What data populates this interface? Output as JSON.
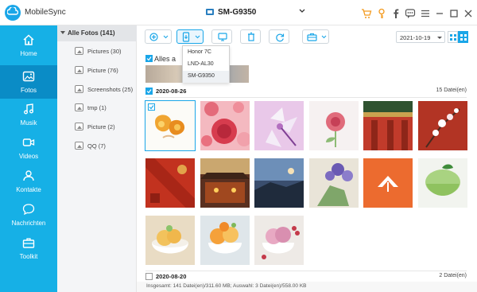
{
  "app": {
    "name": "MobileSync"
  },
  "device": {
    "name": "SM-G9350"
  },
  "titlebar_icons": [
    "cart-icon",
    "key-icon",
    "facebook-icon",
    "chat-icon",
    "menu-icon",
    "minimize-icon",
    "maximize-icon",
    "close-icon"
  ],
  "sidebar": {
    "items": [
      {
        "label": "Home",
        "icon": "home-icon"
      },
      {
        "label": "Fotos",
        "icon": "photo-icon",
        "active": true
      },
      {
        "label": "Musik",
        "icon": "music-icon"
      },
      {
        "label": "Videos",
        "icon": "video-icon"
      },
      {
        "label": "Kontakte",
        "icon": "contacts-icon"
      },
      {
        "label": "Nachrichten",
        "icon": "message-icon"
      },
      {
        "label": "Toolkit",
        "icon": "toolkit-icon"
      }
    ]
  },
  "tree": {
    "root": "Alle Fotos (141)",
    "items": [
      {
        "label": "Pictures (30)"
      },
      {
        "label": "Picture (76)"
      },
      {
        "label": "Screenshots (25)"
      },
      {
        "label": "tmp (1)"
      },
      {
        "label": "Picture (2)"
      },
      {
        "label": "QQ (7)"
      }
    ]
  },
  "toolbar": {
    "buttons": [
      "add-icon",
      "export-to-device-icon",
      "export-to-pc-icon",
      "delete-icon",
      "refresh-icon",
      "toolbox-icon"
    ],
    "date": "2021-10-19"
  },
  "dropdown": {
    "items": [
      {
        "label": "Honor 7C"
      },
      {
        "label": "LND-AL30"
      },
      {
        "label": "SM-G9350",
        "selected": true
      }
    ]
  },
  "content": {
    "select_all_label": "Alles a",
    "groups": [
      {
        "date": "2020-08-26",
        "count": "15 Datei(en)"
      },
      {
        "date": "2020-08-20",
        "count": "2 Datei(en)"
      }
    ]
  },
  "status": {
    "text": "Insgesamt: 141 Datei(en)/311.60 MB; Auswahl: 3 Datei(en)/558.00 KB"
  },
  "colors": {
    "accent": "#1aa6e8",
    "sidebar": "#16b0e6",
    "sidebar_active": "#0a8cc6"
  }
}
